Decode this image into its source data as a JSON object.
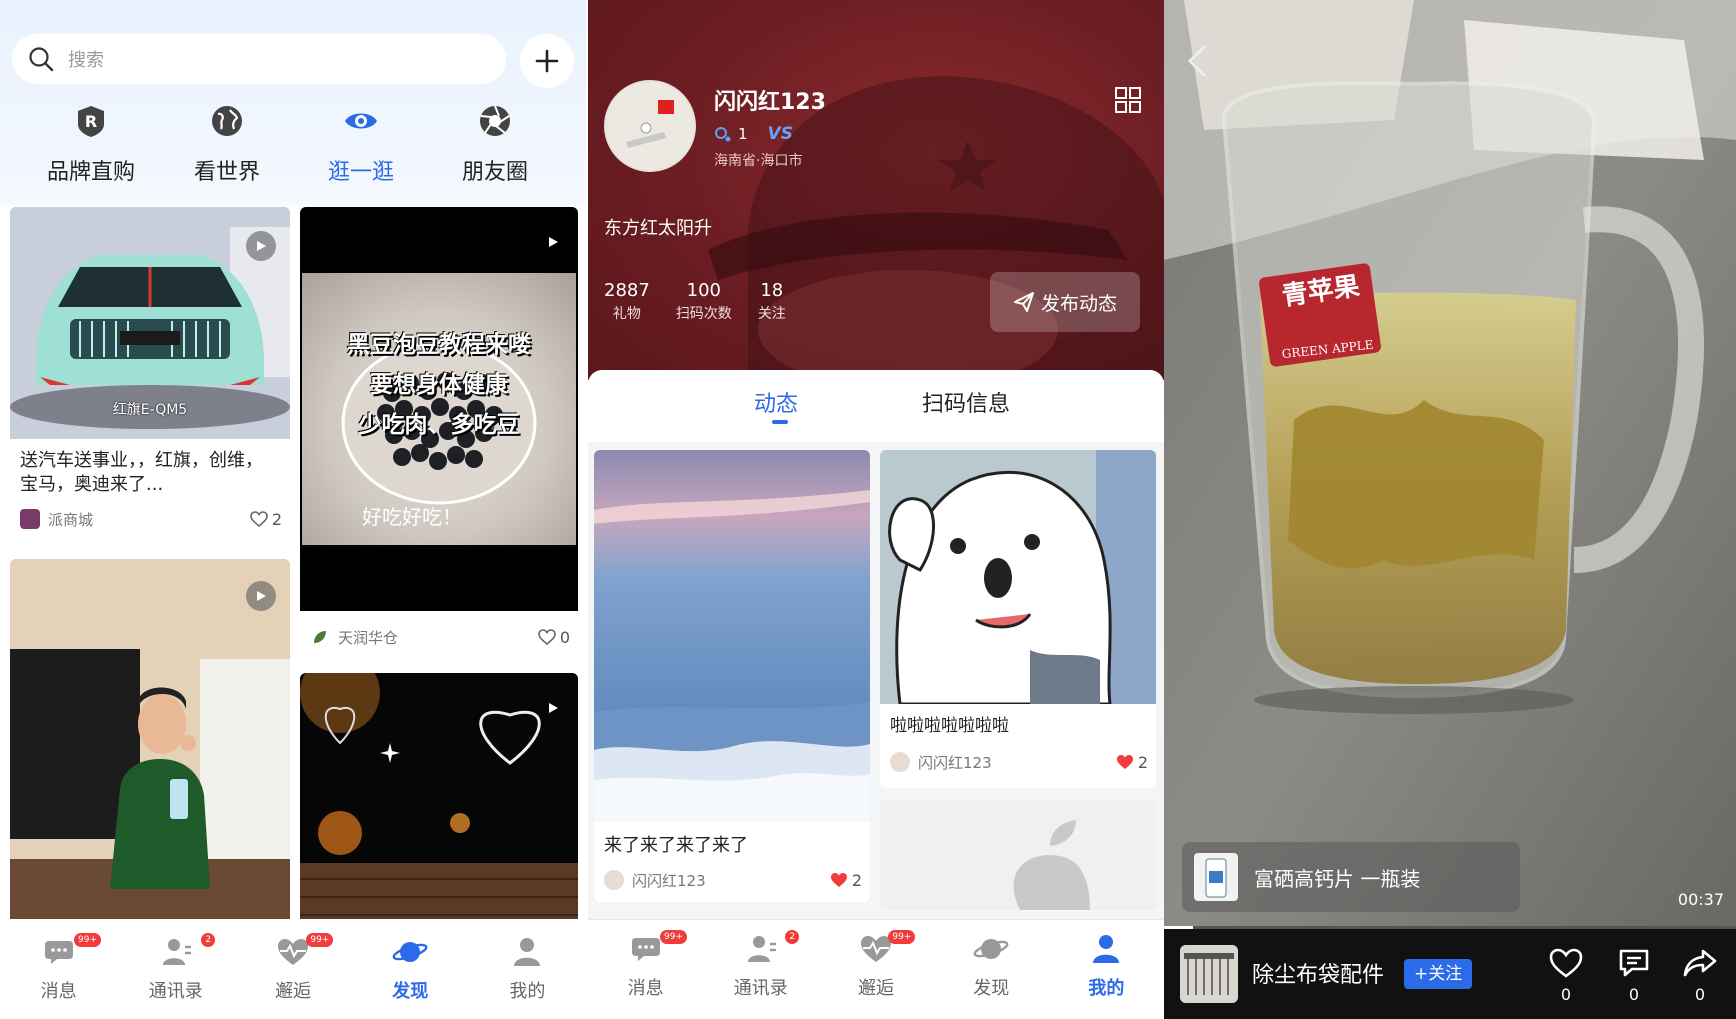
{
  "panel1": {
    "search": {
      "placeholder": "搜索"
    },
    "categories": [
      {
        "label": "品牌直购",
        "icon": "r-badge-icon"
      },
      {
        "label": "看世界",
        "icon": "globe-icon"
      },
      {
        "label": "逛一逛",
        "icon": "eye-icon",
        "active": true
      },
      {
        "label": "朋友圈",
        "icon": "aperture-icon"
      }
    ],
    "cards": [
      {
        "title": "送汽车送事业，，红旗，创维，宝马，奥迪来了...",
        "thumb_caption": "红旗E-QM5",
        "author": "派商城",
        "likes": "2"
      },
      {
        "thumb_text": [
          "黑豆泡豆教程来喽",
          "要想身体健康",
          "少吃肉、多吃豆"
        ],
        "thumb_note": "好吃好吃！",
        "author": "天润华仓",
        "likes": "0"
      }
    ],
    "tabs": [
      {
        "label": "消息",
        "badge": "99+"
      },
      {
        "label": "通讯录",
        "badge": "2"
      },
      {
        "label": "邂逅",
        "badge": "99+"
      },
      {
        "label": "发现",
        "active": true
      },
      {
        "label": "我的"
      }
    ]
  },
  "panel2": {
    "profile": {
      "name": "闪闪红123",
      "level": "1",
      "vip": "VS",
      "location": "海南省·海口市",
      "bio": "东方红太阳升",
      "stats": [
        {
          "value": "2887",
          "label": "礼物"
        },
        {
          "value": "100",
          "label": "扫码次数"
        },
        {
          "value": "18",
          "label": "关注"
        }
      ],
      "publish_label": "发布动态"
    },
    "tabs": [
      "动态",
      "扫码信息"
    ],
    "posts": [
      {
        "title": "来了来了来了来了",
        "author": "闪闪红123",
        "likes": "2"
      },
      {
        "title": "啦啦啦啦啦啦啦",
        "author": "闪闪红123",
        "likes": "2"
      }
    ],
    "nav": [
      {
        "label": "消息",
        "badge": "99+"
      },
      {
        "label": "通讯录",
        "badge": "2"
      },
      {
        "label": "邂逅",
        "badge": "99+"
      },
      {
        "label": "发现"
      },
      {
        "label": "我的",
        "active": true
      }
    ]
  },
  "panel3": {
    "product": "富硒高钙片 一瓶装",
    "time": "00:37",
    "progress_fraction": 0.05,
    "shop_name": "除尘布袋配件",
    "follow_label": "+关注",
    "cup_brand": "青苹果",
    "cup_brand_en": "GREEN APPLE",
    "actions": [
      {
        "icon": "heart-icon",
        "count": "0"
      },
      {
        "icon": "comment-icon",
        "count": "0"
      },
      {
        "icon": "share-icon",
        "count": "0"
      }
    ]
  },
  "colors": {
    "accent": "#2b6ae8",
    "badge": "#f23b3b",
    "hero": "#6b1d22"
  }
}
